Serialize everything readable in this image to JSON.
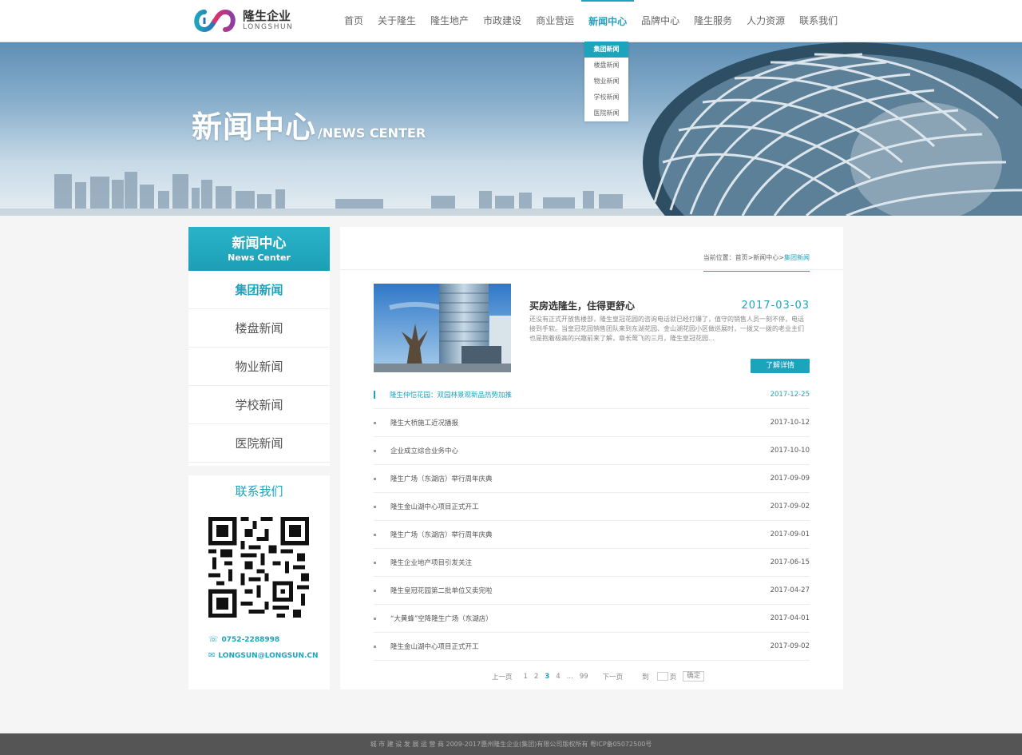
{
  "brand": {
    "name_cn": "隆生企业",
    "name_en": "LONGSHUN"
  },
  "nav": [
    {
      "label": "首页"
    },
    {
      "label": "关于隆生"
    },
    {
      "label": "隆生地产"
    },
    {
      "label": "市政建设"
    },
    {
      "label": "商业营运"
    },
    {
      "label": "新闻中心",
      "active": true
    },
    {
      "label": "品牌中心"
    },
    {
      "label": "隆生服务"
    },
    {
      "label": "人力资源"
    },
    {
      "label": "联系我们"
    }
  ],
  "dropdown": [
    "集团新闻",
    "楼盘新闻",
    "物业新闻",
    "学校新闻",
    "医院新闻"
  ],
  "banner": {
    "title_cn": "新闻中心",
    "title_en": "/NEWS CENTER"
  },
  "sidebar": {
    "head_cn": "新闻中心",
    "head_en": "News Center",
    "items": [
      "集团新闻",
      "楼盘新闻",
      "物业新闻",
      "学校新闻",
      "医院新闻"
    ],
    "contact_title": "联系我们",
    "phone": "0752-2288998",
    "email": "LONGSUN@LONGSUN.CN"
  },
  "breadcrumb": {
    "prefix": "当前位置：首页>新闻中心>",
    "current": "集团新闻"
  },
  "feature": {
    "title": "买房选隆生，住得更舒心",
    "date": "2017-03-03",
    "desc": "还没有正式开放售楼部，隆生皇冠花园的咨询电话就已经打爆了，值守的销售人员一刻不停，电话接到手软。当皇冠花园销售团队来到东湖花园、金山湖花园小区做巡展时，一拨又一拨的老业主们也是抱着极高的兴趣前来了解，章长莺飞的三月，隆生皇冠花园...",
    "more": "了解详情"
  },
  "news": [
    {
      "title": "隆生仲恺花园：双园林景观新品热势加推",
      "date": "2017-12-25"
    },
    {
      "title": "隆生大桥施工近况播报",
      "date": "2017-10-12"
    },
    {
      "title": "企业成立综合业务中心",
      "date": "2017-10-10"
    },
    {
      "title": "隆生广场（东湖店）举行周年庆典",
      "date": "2017-09-09"
    },
    {
      "title": "隆生金山湖中心项目正式开工",
      "date": "2017-09-02"
    },
    {
      "title": "隆生广场（东湖店）举行周年庆典",
      "date": "2017-09-01"
    },
    {
      "title": "隆生企业地产项目引发关注",
      "date": "2017-06-15"
    },
    {
      "title": "隆生皇冠花园第二批单位又卖完啦",
      "date": "2017-04-27"
    },
    {
      "title": "“大黄蜂”空降隆生广场（东湖店）",
      "date": "2017-04-01"
    },
    {
      "title": "隆生金山湖中心项目正式开工",
      "date": "2017-09-02"
    }
  ],
  "pager": {
    "prev": "上一页",
    "pages": [
      "1",
      "2",
      "3",
      "4"
    ],
    "current": "3",
    "ellipsis": "...",
    "last": "99",
    "next": "下一页",
    "goto": "到",
    "page_unit": "页",
    "confirm": "确定"
  },
  "footer": "城 市 建 设 发 展 运 营 商 2009-2017惠州隆生企业(集团)有限公司版权所有   粤ICP备05072500号",
  "colors": {
    "accent": "#1da4bd",
    "footer_bg": "#555555"
  }
}
